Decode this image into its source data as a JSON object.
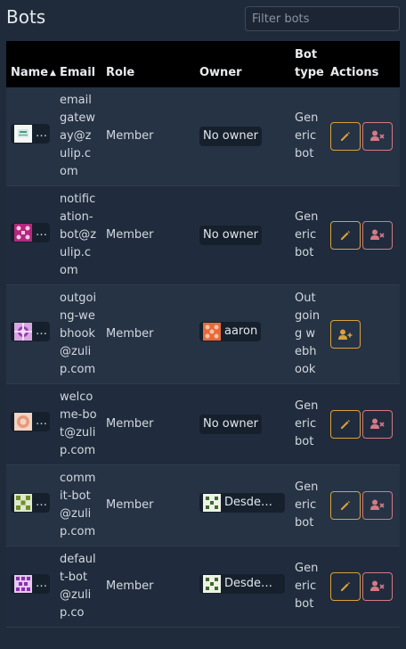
{
  "page": {
    "title": "Bots"
  },
  "search": {
    "placeholder": "Filter bots"
  },
  "table": {
    "headers": {
      "name": "Name",
      "email": "Email",
      "role": "Role",
      "owner": "Owner",
      "bot_type": "Bot type",
      "actions": "Actions"
    },
    "rows": [
      {
        "name": "…",
        "email": "emailgateway@zulip.com",
        "role": "Member",
        "owner": "No owner",
        "bot_type": "Generic bot",
        "active": true
      },
      {
        "name": "…",
        "email": "notification-bot@zulip.com",
        "role": "Member",
        "owner": "No owner",
        "bot_type": "Generic bot",
        "active": true
      },
      {
        "name": "…",
        "email": "outgoing-webhook@zulip.com",
        "role": "Member",
        "owner": "aaron",
        "bot_type": "Outgoing webhook",
        "active": false
      },
      {
        "name": "…",
        "email": "welcome-bot@zulip.com",
        "role": "Member",
        "owner": "No owner",
        "bot_type": "Generic bot",
        "active": true
      },
      {
        "name": "…",
        "email": "commit-bot@zulip.com",
        "role": "Member",
        "owner": "Desdem…",
        "bot_type": "Generic bot",
        "active": true
      },
      {
        "name": "…",
        "email": "default-bot@zulip.co",
        "role": "Member",
        "owner": "Desdem…",
        "bot_type": "Generic bot",
        "active": true
      }
    ]
  },
  "colors": {
    "background": "#1f2b3b",
    "header_bg": "#000000",
    "edit_accent": "#d9a13a",
    "deactivate_accent": "#d27a85"
  },
  "icons": {
    "edit": "pencil-icon",
    "deactivate": "user-x-icon",
    "reactivate": "user-plus-icon",
    "sort": "sort-ascending-icon"
  }
}
